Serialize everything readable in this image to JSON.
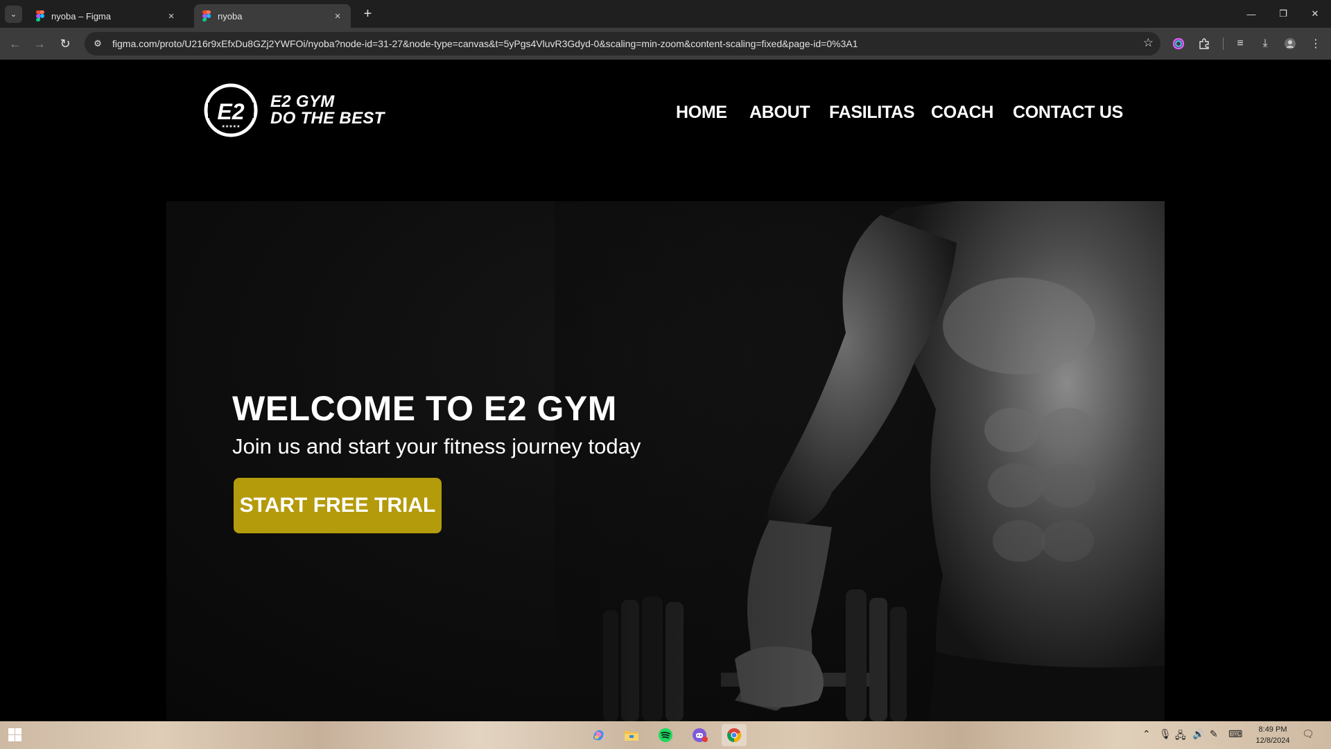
{
  "browser": {
    "tabs": [
      {
        "title": "nyoba – Figma",
        "active": false
      },
      {
        "title": "nyoba",
        "active": true
      }
    ],
    "url": "figma.com/proto/U216r9xEfxDu8GZj2YWFOi/nyoba?node-id=31-27&node-type=canvas&t=5yPgs4VluvR3Gdyd-0&scaling=min-zoom&content-scaling=fixed&page-id=0%3A1",
    "window_controls": {
      "minimize": "—",
      "restore": "❐",
      "close": "✕"
    }
  },
  "site": {
    "logo": {
      "badge_text": "E2",
      "line1": "E2 GYM",
      "line2": "DO THE BEST"
    },
    "nav": [
      "HOME",
      "ABOUT",
      "FASILITAS",
      "COACH",
      "CONTACT US"
    ],
    "hero": {
      "title": "WELCOME TO E2 GYM",
      "subtitle": "Join us and start your fitness journey today",
      "cta": "START FREE TRIAL"
    }
  },
  "taskbar": {
    "apps": [
      "copilot-icon",
      "file-explorer-icon",
      "spotify-icon",
      "discord-icon",
      "chrome-icon"
    ],
    "clock": {
      "time": "8:49 PM",
      "date": "12/8/2024"
    }
  },
  "colors": {
    "cta": "#b49b0c",
    "page_bg": "#000000",
    "chrome_bg": "#1f1f1f",
    "toolbar_bg": "#3c3c3c"
  }
}
